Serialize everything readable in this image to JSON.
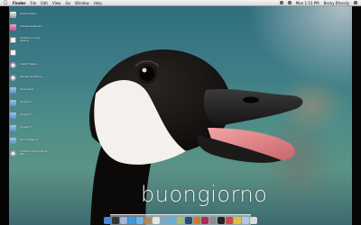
{
  "menubar": {
    "app_menu": "Finder",
    "menus": [
      "File",
      "Edit",
      "View",
      "Go",
      "Window",
      "Help"
    ],
    "clock": "Mon 1:53 PM",
    "user": "Becky Bhondy"
  },
  "desktop_icons": [
    {
      "label": "OSXLeopard",
      "icon": "hard-drive-icon"
    },
    {
      "label": "Adobe Illustrator",
      "icon": "pink-app-icon"
    },
    {
      "label": "Untitled 1 Lady Liberty",
      "icon": "document-icon"
    },
    {
      "label": "",
      "icon": "document-icon"
    },
    {
      "label": "Install Media",
      "icon": "disc-icon"
    },
    {
      "label": "Reveal for Items",
      "icon": "disc-icon"
    },
    {
      "label": "Oversized",
      "icon": "folder-icon"
    },
    {
      "label": "Project 1",
      "icon": "folder-icon"
    },
    {
      "label": "Project 2",
      "icon": "folder-icon"
    },
    {
      "label": "Project 3",
      "icon": "folder-icon"
    },
    {
      "label": "HD Untitled 2",
      "icon": "folder-icon"
    },
    {
      "label": "Untitled Folder Book Bits",
      "icon": "disc-icon"
    }
  ],
  "wallpaper": {
    "greeting": "buongiorno",
    "subject": "canada-goose-icon"
  },
  "dock": {
    "items": [
      {
        "name": "finder-dock-icon",
        "color": "#4a86d6"
      },
      {
        "name": "dashboard-dock-icon",
        "color": "#333333"
      },
      {
        "name": "mail-dock-icon",
        "color": "#9fb8d9"
      },
      {
        "name": "safari-dock-icon",
        "color": "#3a9be0"
      },
      {
        "name": "ichat-dock-icon",
        "color": "#68b4e8"
      },
      {
        "name": "address-book-dock-icon",
        "color": "#b08a5a"
      },
      {
        "name": "ical-dock-icon",
        "color": "#e6e6e6"
      },
      {
        "name": "preview-dock-icon",
        "color": "#7aa8c9"
      },
      {
        "name": "itunes-dock-icon",
        "color": "#5fb0e0"
      },
      {
        "name": "iphoto-dock-icon",
        "color": "#a0c070"
      },
      {
        "name": "photoshop-dock-icon",
        "color": "#2a4a7a"
      },
      {
        "name": "illustrator-dock-icon",
        "color": "#d07a28"
      },
      {
        "name": "indesign-dock-icon",
        "color": "#b02a5a"
      },
      {
        "name": "system-prefs-dock-icon",
        "color": "#8c8c8c"
      },
      {
        "name": "terminal-dock-icon",
        "color": "#222222"
      },
      {
        "name": "app-a-dock-icon",
        "color": "#c94a4a"
      },
      {
        "name": "app-b-dock-icon",
        "color": "#e0c040"
      },
      {
        "name": "downloads-dock-icon",
        "color": "#b0c8e8"
      },
      {
        "name": "trash-dock-icon",
        "color": "#dcdcdc"
      }
    ]
  }
}
